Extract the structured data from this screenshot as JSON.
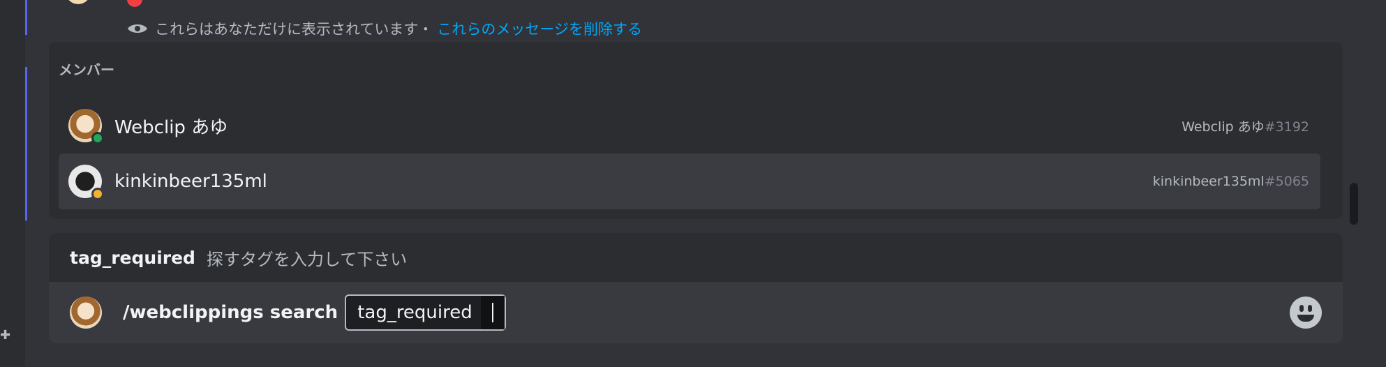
{
  "ephemeral": {
    "notice": "これらはあなただけに表示されています・",
    "delete_link": "これらのメッセージを削除する"
  },
  "members": {
    "header": "メンバー",
    "items": [
      {
        "name": "Webclip あゆ",
        "username": "Webclip あゆ",
        "discriminator": "#3192",
        "status": "online"
      },
      {
        "name": "kinkinbeer135ml",
        "username": "kinkinbeer135ml",
        "discriminator": "#5065",
        "status": "idle"
      }
    ]
  },
  "hint": {
    "option_name": "tag_required",
    "description": "探すタグを入力して下さい"
  },
  "input": {
    "command": "/webclippings search",
    "option_label": "tag_required"
  },
  "colors": {
    "accent": "#5865f2",
    "link": "#00a8fc",
    "online": "#23a55a",
    "idle": "#f0b232",
    "error": "#f23f43"
  },
  "icons": {
    "visibility": "eye-icon",
    "emoji": "emoji-smile-icon"
  }
}
